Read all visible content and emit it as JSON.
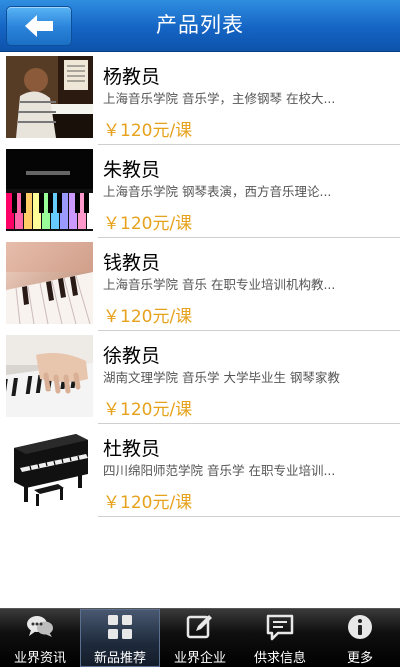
{
  "header": {
    "title": "产品列表",
    "back_icon": "back-arrow-icon"
  },
  "products": [
    {
      "name": "杨教员",
      "description": "上海音乐学院 音乐学，主修钢琴 在校大...",
      "price": "￥120元/课",
      "image": "child-playing-piano-photo"
    },
    {
      "name": "朱教员",
      "description": "上海音乐学院 钢琴表演，西方音乐理论...",
      "price": "￥120元/课",
      "image": "rainbow-piano-keys-photo"
    },
    {
      "name": "钱教员",
      "description": "上海音乐学院 音乐 在职专业培训机构教...",
      "price": "￥120元/课",
      "image": "piano-keys-closeup-photo"
    },
    {
      "name": "徐教员",
      "description": "湖南文理学院 音乐学 大学毕业生 钢琴家教",
      "price": "￥120元/课",
      "image": "hands-on-piano-photo"
    },
    {
      "name": "杜教员",
      "description": "四川绵阳师范学院 音乐学 在职专业培训...",
      "price": "￥120元/课",
      "image": "upright-piano-photo"
    }
  ],
  "tabbar": {
    "tabs": [
      {
        "label": "业界资讯",
        "icon": "chat-bubbles-icon",
        "active": false
      },
      {
        "label": "新品推荐",
        "icon": "grid-icon",
        "active": true
      },
      {
        "label": "业界企业",
        "icon": "edit-icon",
        "active": false
      },
      {
        "label": "供求信息",
        "icon": "message-icon",
        "active": false
      },
      {
        "label": "更多",
        "icon": "info-icon",
        "active": false
      }
    ]
  }
}
